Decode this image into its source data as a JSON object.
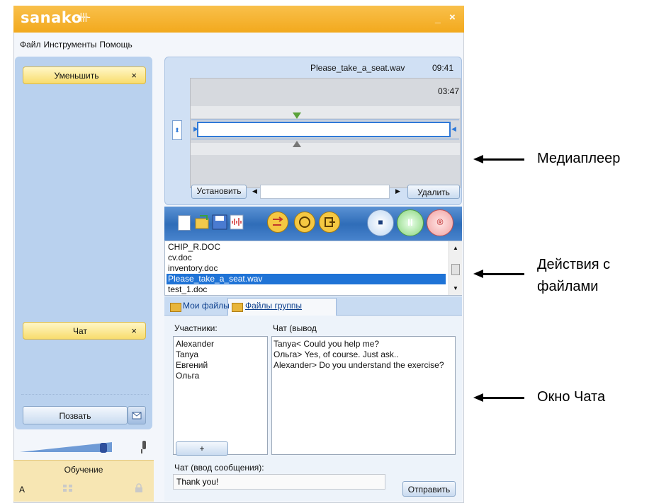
{
  "app": {
    "logo": "sanako",
    "logo_wave": "-∙|∙|∙|∙-",
    "minimize": "_",
    "close": "×"
  },
  "menu": [
    "Файл",
    "Инструменты",
    "Помощь"
  ],
  "left_panel": {
    "collapse_label": "Уменьшить",
    "chat_label": "Чат",
    "close_glyph": "×",
    "call_label": "Позвать",
    "volume_level": 0.87,
    "training_title": "Обучение",
    "training_letter": "A"
  },
  "media": {
    "filename": "Please_take_a_seat.wav",
    "total_time": "09:41",
    "current_time": "03:47",
    "set_label": "Установить",
    "delete_label": "Удалить"
  },
  "toolbar": {
    "stop_glyph": "■",
    "pause_glyph": "II",
    "record_glyph": "®"
  },
  "files": [
    "CHIP_R.DOC",
    "cv.doc",
    "inventory.doc",
    "Please_take_a_seat.wav",
    "test_1.doc"
  ],
  "selected_file": "Please_take_a_seat.wav",
  "tabs": [
    "Мои файлы",
    "Файлы группы"
  ],
  "chat": {
    "participants_label": "Участники:",
    "output_label": "Чат (вывод",
    "participants": [
      "Alexander",
      "Tanya",
      "Евгений",
      "Ольга"
    ],
    "messages": [
      "Tanya< Could you help me?",
      "Ольга> Yes, of course. Just ask..",
      "Alexander> Do you understand the exercise?"
    ],
    "add_label": "+",
    "input_label": "Чат (ввод сообщения):",
    "input_value": "Thank you!",
    "send_label": "Отправить"
  },
  "annotations": {
    "media_player": "Медиаплеер",
    "file_actions_1": "Действия с",
    "file_actions_2": "файлами",
    "chat_window": "Окно Чата"
  },
  "colors": {
    "title_bar": "#f2a91d",
    "panel_blue": "#b9d1ee",
    "selection": "#1f73d6",
    "training_bg": "#f7e6b3"
  }
}
